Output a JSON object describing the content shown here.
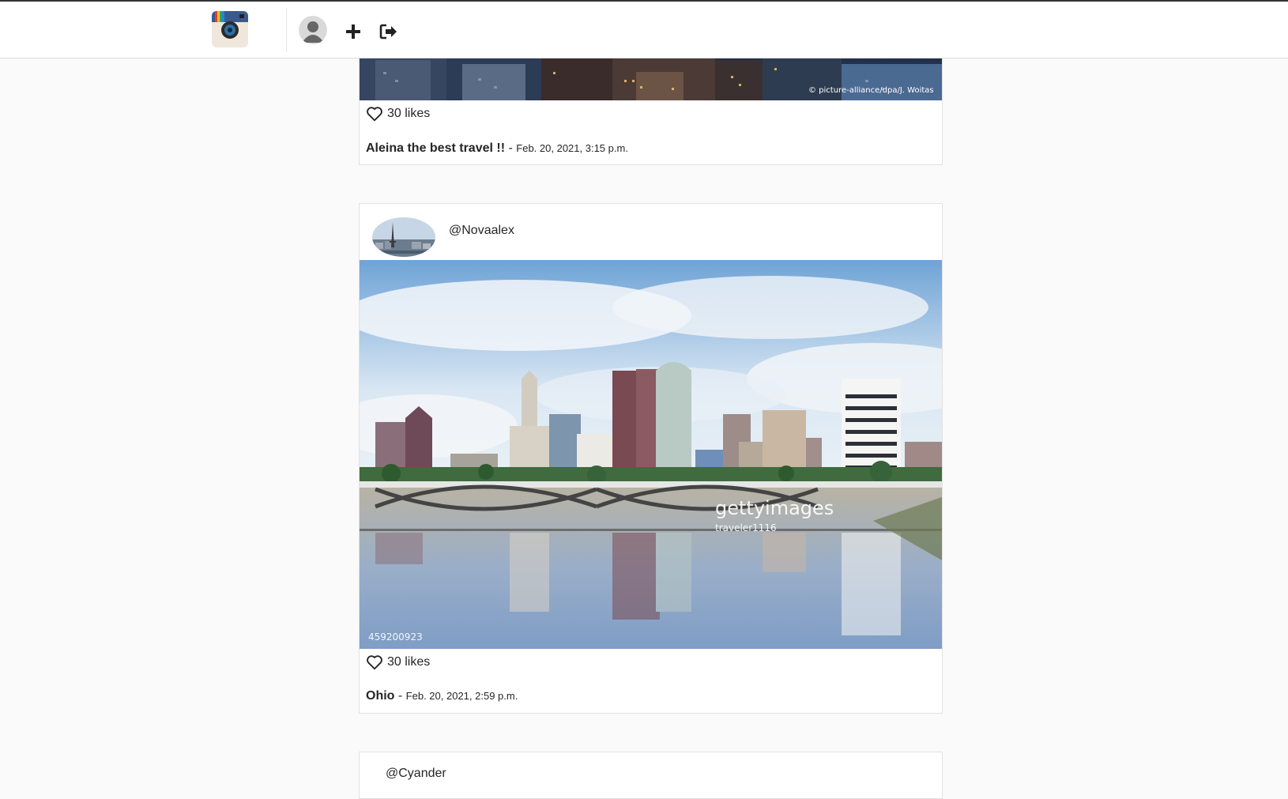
{
  "nav": {
    "logo_icon": "camera-app-logo-icon",
    "profile_icon": "user-avatar-icon",
    "add_icon": "plus-icon",
    "logout_icon": "sign-out-icon"
  },
  "posts": [
    {
      "image_credit": "© picture-alliance/dpa/J. Woitas",
      "likes_text": "30 likes",
      "caption_title": "Aleina the best travel !!",
      "separator": "-",
      "date": "Feb. 20, 2021, 3:15 p.m."
    },
    {
      "username": "@Novaalex",
      "image_watermark": "gettyimages",
      "image_watermark_user": "traveler1116",
      "image_id": "459200923",
      "likes_text": "30 likes",
      "caption_title": "Ohio",
      "separator": "-",
      "date": "Feb. 20, 2021, 2:59 p.m."
    },
    {
      "username": "@Cyander"
    }
  ],
  "colors": {
    "background": "#fafafa",
    "card": "#ffffff",
    "border": "#e1e1e1",
    "text": "#262626"
  }
}
